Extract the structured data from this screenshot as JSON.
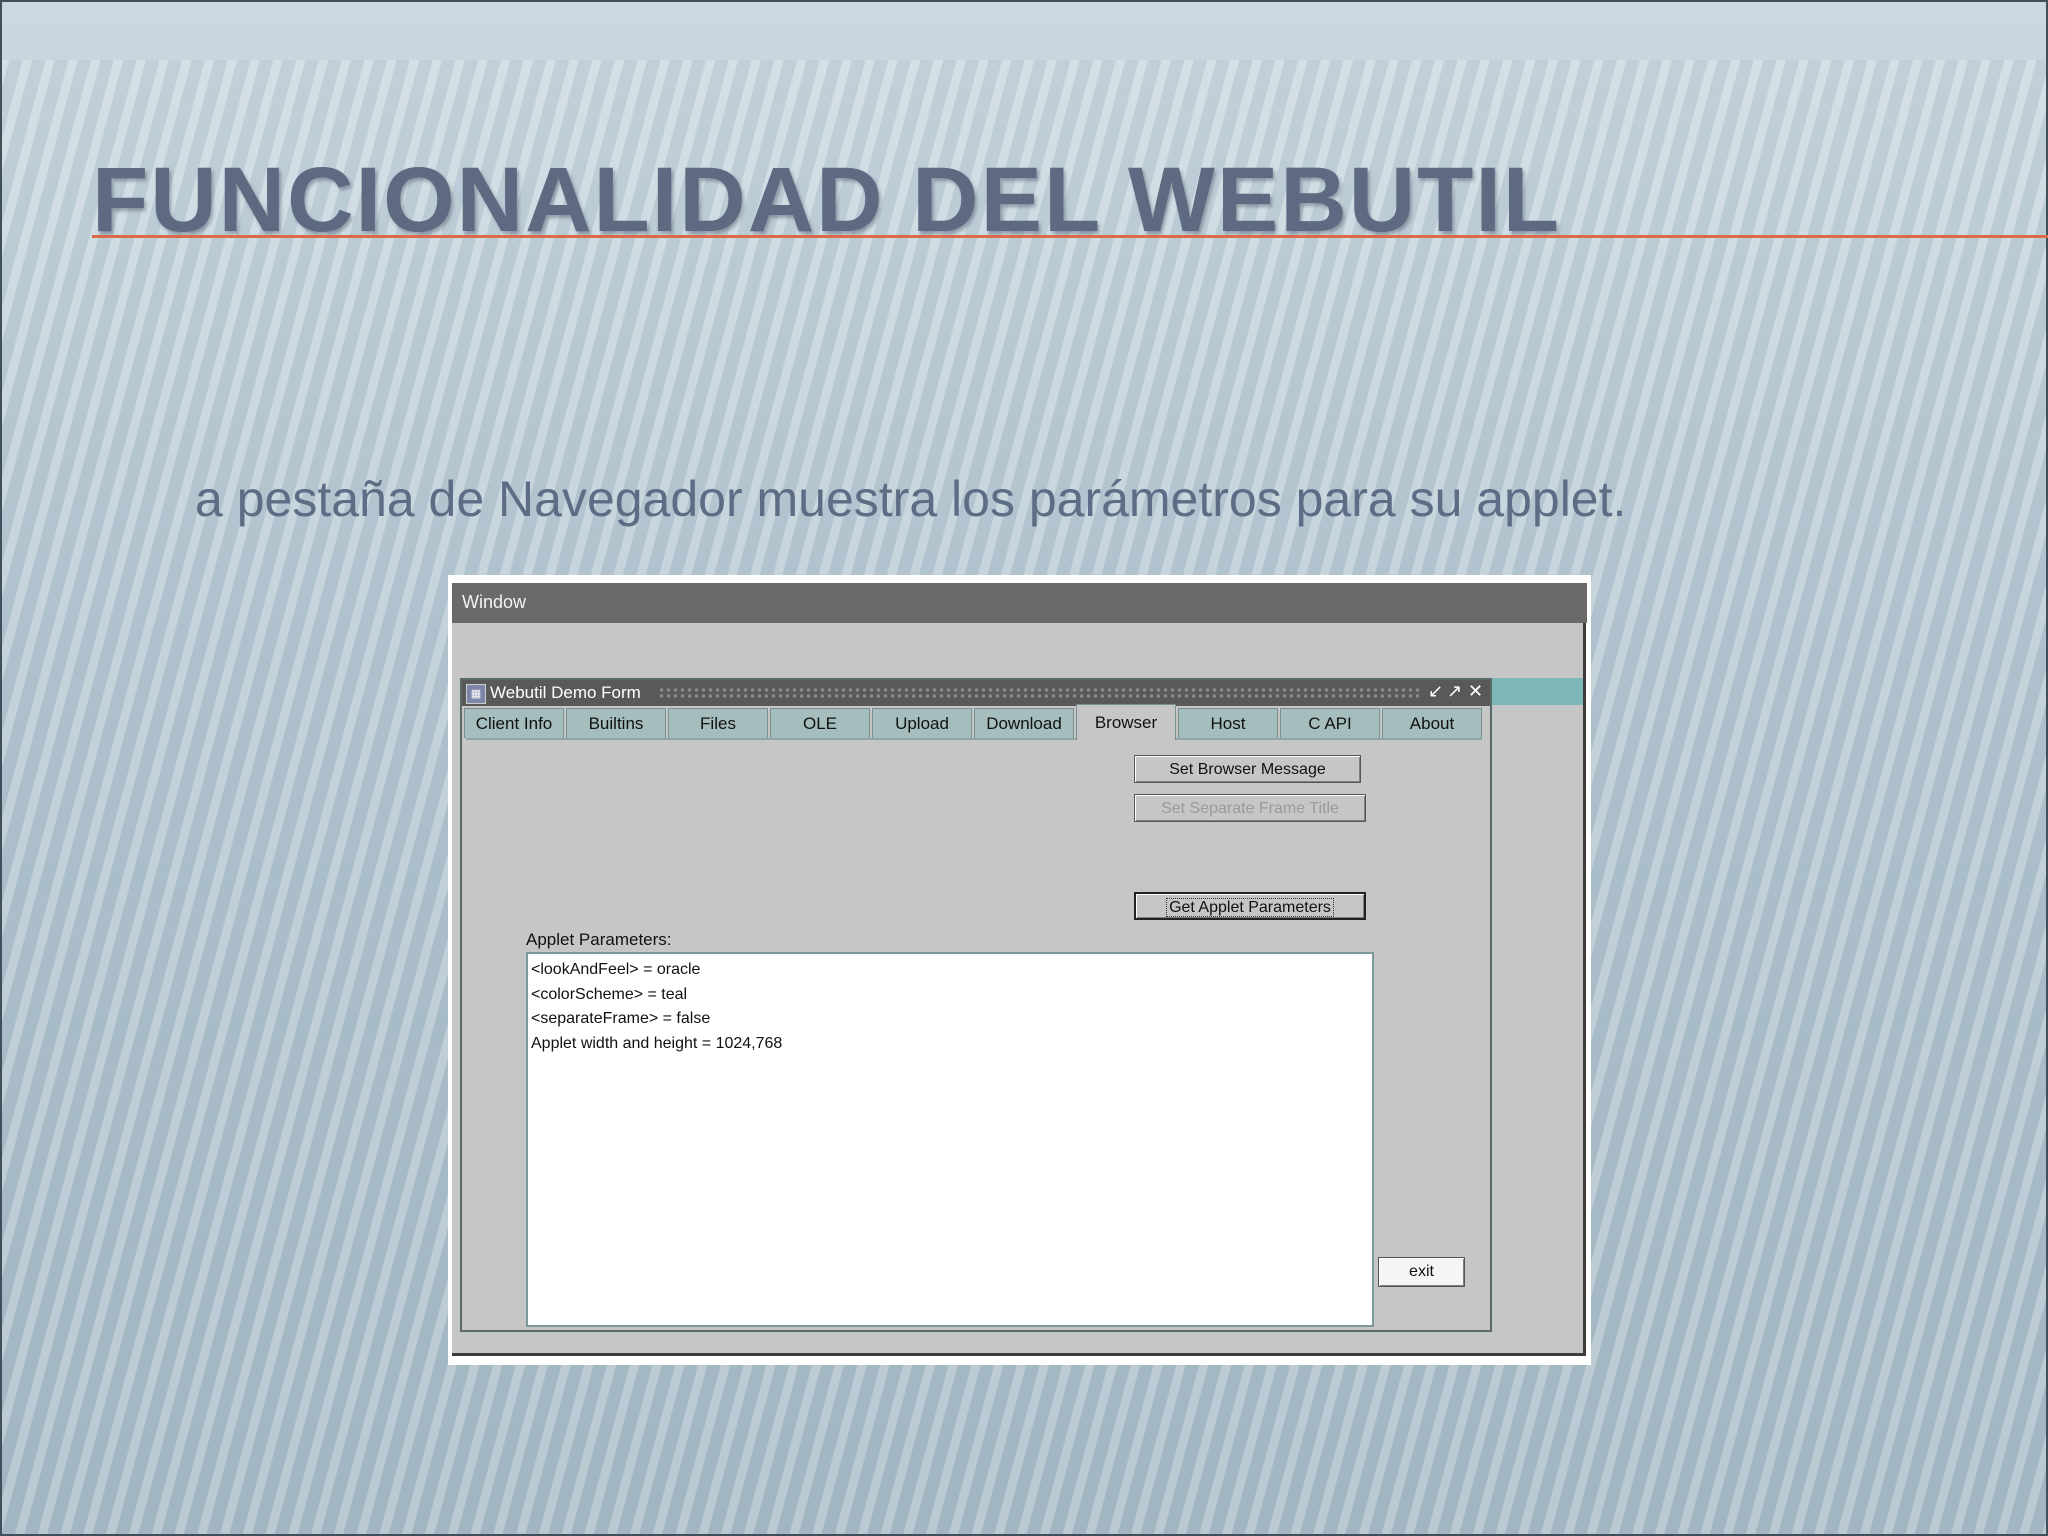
{
  "slide": {
    "title": "FUNCIONALIDAD DEL WEBUTIL",
    "subtitle": "a pestaña de Navegador muestra los parámetros para su applet."
  },
  "app": {
    "menu": {
      "window": "Window"
    },
    "form": {
      "title": "Webutil Demo Form",
      "tabs": [
        {
          "label": "Client Info",
          "active": false
        },
        {
          "label": "Builtins",
          "active": false
        },
        {
          "label": "Files",
          "active": false
        },
        {
          "label": "OLE",
          "active": false
        },
        {
          "label": "Upload",
          "active": false
        },
        {
          "label": "Download",
          "active": false
        },
        {
          "label": "Browser",
          "active": true
        },
        {
          "label": "Host",
          "active": false
        },
        {
          "label": "C API",
          "active": false
        },
        {
          "label": "About",
          "active": false
        }
      ],
      "buttons": {
        "set_browser_message": "Set Browser Message",
        "set_separate_frame_title": "Set Separate Frame Title",
        "get_applet_parameters": "Get Applet Parameters",
        "exit": "exit"
      },
      "params_label": "Applet Parameters:",
      "params_lines": [
        "<lookAndFeel> = oracle",
        "<colorScheme> = teal",
        "<separateFrame> = false",
        "Applet width and height = 1024,768"
      ]
    }
  },
  "colors": {
    "title": "#5d6a82",
    "accent_rule": "#d96a4a",
    "tab": "#a5bdbd",
    "titlebar": "#595959",
    "teal_strip": "#7fb8b8"
  },
  "icons": [
    "minimize-icon",
    "restore-icon",
    "close-icon",
    "form-app-icon"
  ]
}
